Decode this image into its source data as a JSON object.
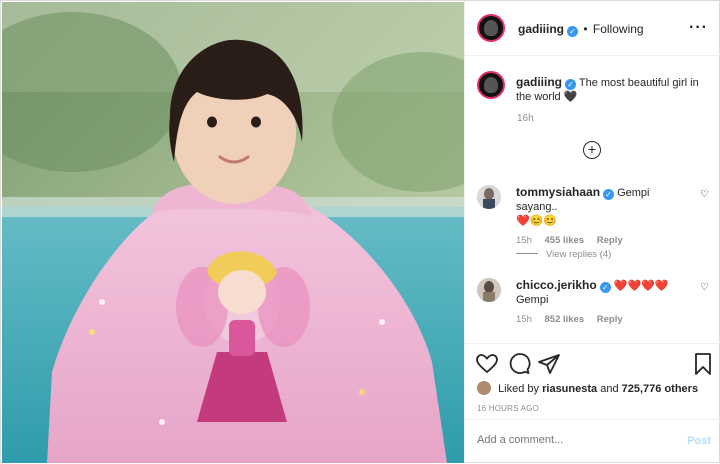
{
  "header": {
    "username": "gadiiing",
    "separator": "•",
    "following": "Following",
    "more_icon": "more-dots-icon"
  },
  "caption": {
    "username": "gadiiing",
    "text": "The most beautiful girl in the world 🖤",
    "time": "16h"
  },
  "comments": [
    {
      "username": "tommysiahaan",
      "text": "Gempi sayang..",
      "emojis": "❤️😊😊",
      "time": "15h",
      "likes": "455 likes",
      "reply": "Reply",
      "view_replies": "View replies (4)"
    },
    {
      "username": "chicco.jerikho",
      "text": "❤️❤️❤️❤️",
      "text2": "Gempi",
      "time": "15h",
      "likes": "852 likes",
      "reply": "Reply"
    }
  ],
  "actions": {
    "liked_by_prefix": "Liked by",
    "liked_by_user": "riasunesta",
    "liked_by_and": "and",
    "liked_by_count": "725,776 others",
    "timestamp": "16 HOURS AGO"
  },
  "composer": {
    "placeholder": "Add a comment...",
    "post_label": "Post"
  },
  "colors": {
    "verified": "#3897f0",
    "link": "#0095f6",
    "muted": "#8e8e8e",
    "heart_red": "#ed4956"
  }
}
